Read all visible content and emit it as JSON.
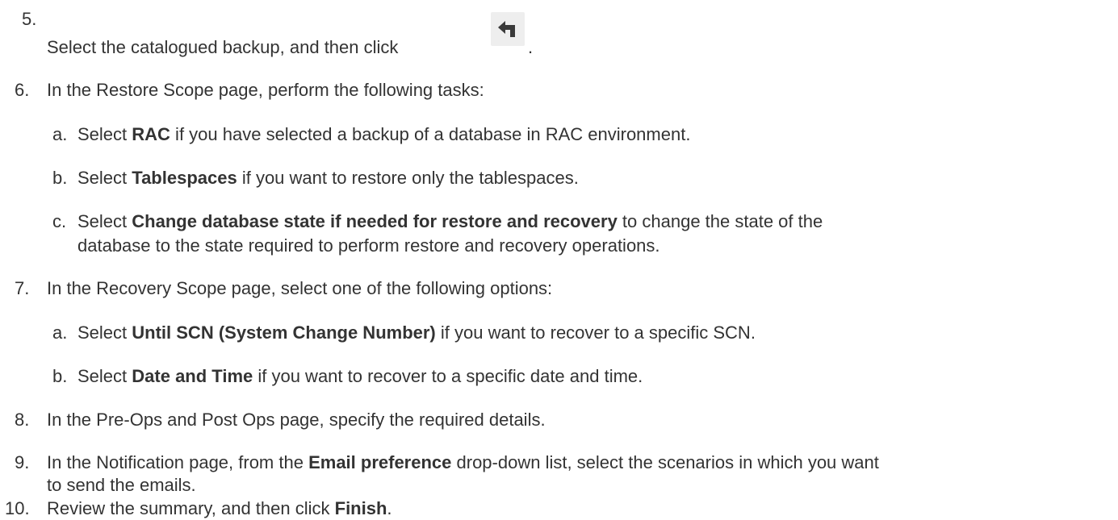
{
  "steps": [
    {
      "num": "5.",
      "text": "Select the catalogued backup, and then click ",
      "tail": "."
    },
    {
      "num": "6.",
      "text": "In the Restore Scope page, perform the following tasks:",
      "sub": [
        {
          "letter": "a.",
          "pre": "Select ",
          "bold": "RAC",
          "post": " if you have selected a backup of a database in RAC environment."
        },
        {
          "letter": "b.",
          "pre": "Select ",
          "bold": "Tablespaces",
          "post": " if you want to restore only the tablespaces."
        },
        {
          "letter": "c.",
          "pre": "Select ",
          "bold": "Change database state if needed for restore and recovery",
          "post": " to change the state of the",
          "line2": "database to the state required to perform restore and recovery operations."
        }
      ]
    },
    {
      "num": "7.",
      "text": "In the Recovery Scope page, select one of the following options:",
      "sub": [
        {
          "letter": "a.",
          "pre": "Select ",
          "bold": "Until SCN (System Change Number)",
          "post": " if you want to recover to a specific SCN."
        },
        {
          "letter": "b.",
          "pre": "Select ",
          "bold": "Date and Time",
          "post": " if you want to recover to a specific date and time."
        }
      ]
    },
    {
      "num": "8.",
      "text": "In the Pre-Ops and Post Ops page, specify the required details."
    },
    {
      "num": "9.",
      "pre": "In the Notification page, from the ",
      "bold": "Email preference",
      "post": " drop-down list, select the scenarios in which you want",
      "line2": "to send the emails."
    },
    {
      "num": "10.",
      "pre": "Review the summary, and then click ",
      "bold": "Finish",
      "post": "."
    }
  ],
  "icons": {
    "restore": "restore-arrow-icon"
  }
}
